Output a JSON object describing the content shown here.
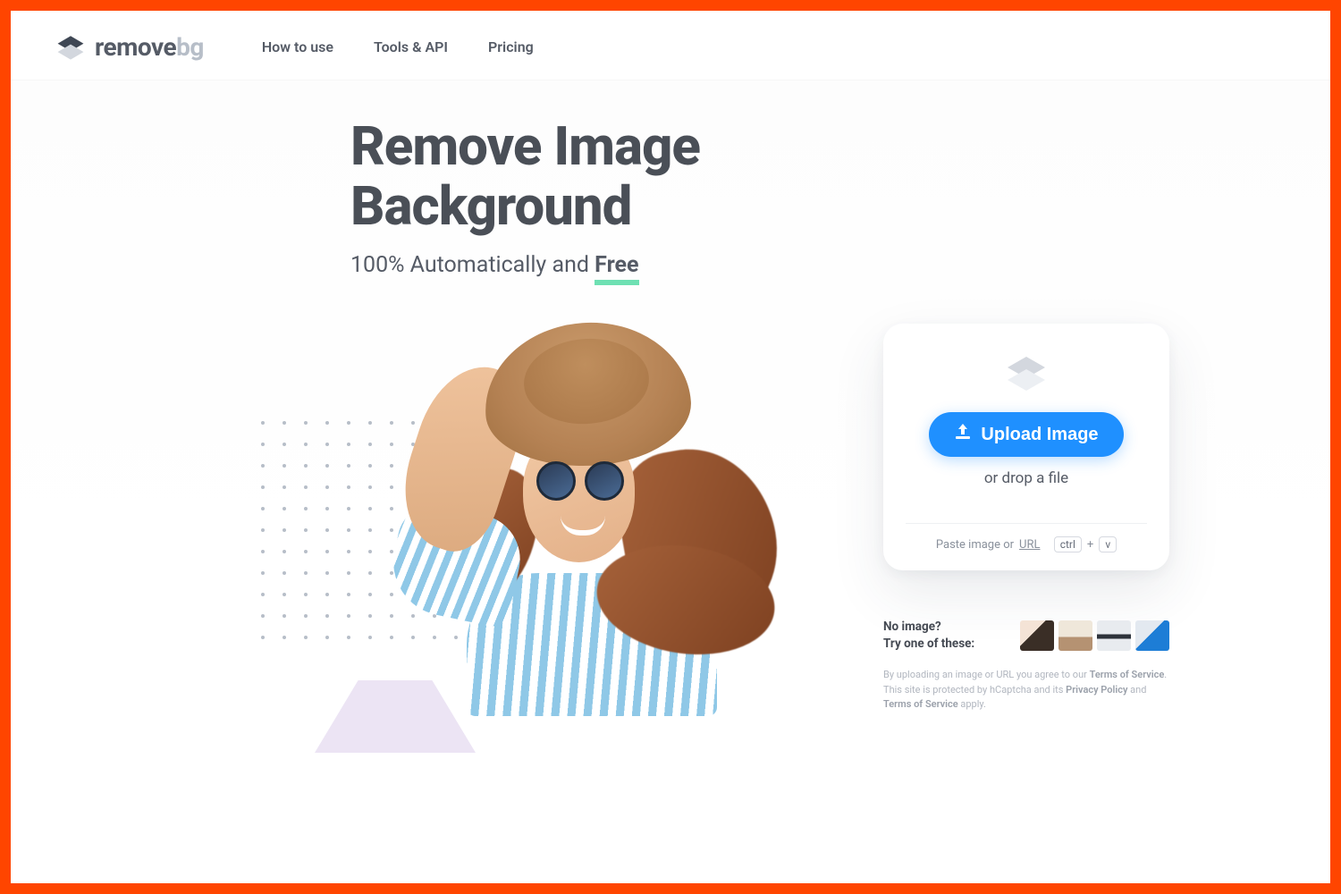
{
  "brand": {
    "name_part1": "remove",
    "name_part2": "bg"
  },
  "nav": {
    "how": "How to use",
    "tools": "Tools & API",
    "pricing": "Pricing"
  },
  "hero": {
    "title_line1": "Remove Image",
    "title_line2": "Background",
    "subtitle_prefix": "100% Automatically and ",
    "subtitle_free": "Free"
  },
  "upload": {
    "button": "Upload Image",
    "drop": "or drop a file",
    "paste_prefix": "Paste image or ",
    "paste_url": "URL",
    "key1": "ctrl",
    "key_plus": "+",
    "key2": "v"
  },
  "samples": {
    "line1": "No image?",
    "line2": "Try one of these:"
  },
  "legal": {
    "t1": "By uploading an image or URL you agree to our ",
    "tos": "Terms of Service",
    "t2": ". This site is protected by hCaptcha and its ",
    "pp": "Privacy Policy",
    "t3": " and ",
    "tos2": "Terms of Service",
    "t4": " apply."
  }
}
